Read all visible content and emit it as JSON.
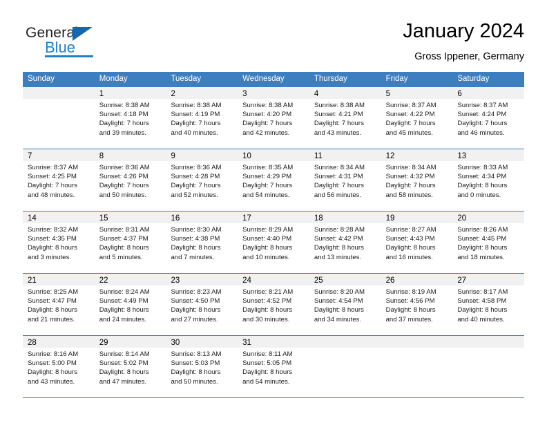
{
  "logo": {
    "word1": "General",
    "word2": "Blue",
    "triangle_icon": "triangle-icon",
    "color_dark": "#231f20",
    "color_blue": "#1f7fc4"
  },
  "header": {
    "title": "January 2024",
    "subtitle": "Gross Ippener, Germany"
  },
  "theme": {
    "header_row_bg": "#3c7ebf",
    "day_band_bg": "#f1f1f1",
    "grid_line": "#3c7ebf"
  },
  "calendar": {
    "weekday_headers": [
      "Sunday",
      "Monday",
      "Tuesday",
      "Wednesday",
      "Thursday",
      "Friday",
      "Saturday"
    ],
    "weeks": [
      [
        {
          "day": "",
          "sunrise": "",
          "sunset": "",
          "daylight_line1": "",
          "daylight_line2": "",
          "empty": true
        },
        {
          "day": "1",
          "sunrise": "Sunrise: 8:38 AM",
          "sunset": "Sunset: 4:18 PM",
          "daylight_line1": "Daylight: 7 hours",
          "daylight_line2": "and 39 minutes."
        },
        {
          "day": "2",
          "sunrise": "Sunrise: 8:38 AM",
          "sunset": "Sunset: 4:19 PM",
          "daylight_line1": "Daylight: 7 hours",
          "daylight_line2": "and 40 minutes."
        },
        {
          "day": "3",
          "sunrise": "Sunrise: 8:38 AM",
          "sunset": "Sunset: 4:20 PM",
          "daylight_line1": "Daylight: 7 hours",
          "daylight_line2": "and 42 minutes."
        },
        {
          "day": "4",
          "sunrise": "Sunrise: 8:38 AM",
          "sunset": "Sunset: 4:21 PM",
          "daylight_line1": "Daylight: 7 hours",
          "daylight_line2": "and 43 minutes."
        },
        {
          "day": "5",
          "sunrise": "Sunrise: 8:37 AM",
          "sunset": "Sunset: 4:22 PM",
          "daylight_line1": "Daylight: 7 hours",
          "daylight_line2": "and 45 minutes."
        },
        {
          "day": "6",
          "sunrise": "Sunrise: 8:37 AM",
          "sunset": "Sunset: 4:24 PM",
          "daylight_line1": "Daylight: 7 hours",
          "daylight_line2": "and 46 minutes."
        }
      ],
      [
        {
          "day": "7",
          "sunrise": "Sunrise: 8:37 AM",
          "sunset": "Sunset: 4:25 PM",
          "daylight_line1": "Daylight: 7 hours",
          "daylight_line2": "and 48 minutes."
        },
        {
          "day": "8",
          "sunrise": "Sunrise: 8:36 AM",
          "sunset": "Sunset: 4:26 PM",
          "daylight_line1": "Daylight: 7 hours",
          "daylight_line2": "and 50 minutes."
        },
        {
          "day": "9",
          "sunrise": "Sunrise: 8:36 AM",
          "sunset": "Sunset: 4:28 PM",
          "daylight_line1": "Daylight: 7 hours",
          "daylight_line2": "and 52 minutes."
        },
        {
          "day": "10",
          "sunrise": "Sunrise: 8:35 AM",
          "sunset": "Sunset: 4:29 PM",
          "daylight_line1": "Daylight: 7 hours",
          "daylight_line2": "and 54 minutes."
        },
        {
          "day": "11",
          "sunrise": "Sunrise: 8:34 AM",
          "sunset": "Sunset: 4:31 PM",
          "daylight_line1": "Daylight: 7 hours",
          "daylight_line2": "and 56 minutes."
        },
        {
          "day": "12",
          "sunrise": "Sunrise: 8:34 AM",
          "sunset": "Sunset: 4:32 PM",
          "daylight_line1": "Daylight: 7 hours",
          "daylight_line2": "and 58 minutes."
        },
        {
          "day": "13",
          "sunrise": "Sunrise: 8:33 AM",
          "sunset": "Sunset: 4:34 PM",
          "daylight_line1": "Daylight: 8 hours",
          "daylight_line2": "and 0 minutes."
        }
      ],
      [
        {
          "day": "14",
          "sunrise": "Sunrise: 8:32 AM",
          "sunset": "Sunset: 4:35 PM",
          "daylight_line1": "Daylight: 8 hours",
          "daylight_line2": "and 3 minutes."
        },
        {
          "day": "15",
          "sunrise": "Sunrise: 8:31 AM",
          "sunset": "Sunset: 4:37 PM",
          "daylight_line1": "Daylight: 8 hours",
          "daylight_line2": "and 5 minutes."
        },
        {
          "day": "16",
          "sunrise": "Sunrise: 8:30 AM",
          "sunset": "Sunset: 4:38 PM",
          "daylight_line1": "Daylight: 8 hours",
          "daylight_line2": "and 7 minutes."
        },
        {
          "day": "17",
          "sunrise": "Sunrise: 8:29 AM",
          "sunset": "Sunset: 4:40 PM",
          "daylight_line1": "Daylight: 8 hours",
          "daylight_line2": "and 10 minutes."
        },
        {
          "day": "18",
          "sunrise": "Sunrise: 8:28 AM",
          "sunset": "Sunset: 4:42 PM",
          "daylight_line1": "Daylight: 8 hours",
          "daylight_line2": "and 13 minutes."
        },
        {
          "day": "19",
          "sunrise": "Sunrise: 8:27 AM",
          "sunset": "Sunset: 4:43 PM",
          "daylight_line1": "Daylight: 8 hours",
          "daylight_line2": "and 16 minutes."
        },
        {
          "day": "20",
          "sunrise": "Sunrise: 8:26 AM",
          "sunset": "Sunset: 4:45 PM",
          "daylight_line1": "Daylight: 8 hours",
          "daylight_line2": "and 18 minutes."
        }
      ],
      [
        {
          "day": "21",
          "sunrise": "Sunrise: 8:25 AM",
          "sunset": "Sunset: 4:47 PM",
          "daylight_line1": "Daylight: 8 hours",
          "daylight_line2": "and 21 minutes."
        },
        {
          "day": "22",
          "sunrise": "Sunrise: 8:24 AM",
          "sunset": "Sunset: 4:49 PM",
          "daylight_line1": "Daylight: 8 hours",
          "daylight_line2": "and 24 minutes."
        },
        {
          "day": "23",
          "sunrise": "Sunrise: 8:23 AM",
          "sunset": "Sunset: 4:50 PM",
          "daylight_line1": "Daylight: 8 hours",
          "daylight_line2": "and 27 minutes."
        },
        {
          "day": "24",
          "sunrise": "Sunrise: 8:21 AM",
          "sunset": "Sunset: 4:52 PM",
          "daylight_line1": "Daylight: 8 hours",
          "daylight_line2": "and 30 minutes."
        },
        {
          "day": "25",
          "sunrise": "Sunrise: 8:20 AM",
          "sunset": "Sunset: 4:54 PM",
          "daylight_line1": "Daylight: 8 hours",
          "daylight_line2": "and 34 minutes."
        },
        {
          "day": "26",
          "sunrise": "Sunrise: 8:19 AM",
          "sunset": "Sunset: 4:56 PM",
          "daylight_line1": "Daylight: 8 hours",
          "daylight_line2": "and 37 minutes."
        },
        {
          "day": "27",
          "sunrise": "Sunrise: 8:17 AM",
          "sunset": "Sunset: 4:58 PM",
          "daylight_line1": "Daylight: 8 hours",
          "daylight_line2": "and 40 minutes."
        }
      ],
      [
        {
          "day": "28",
          "sunrise": "Sunrise: 8:16 AM",
          "sunset": "Sunset: 5:00 PM",
          "daylight_line1": "Daylight: 8 hours",
          "daylight_line2": "and 43 minutes."
        },
        {
          "day": "29",
          "sunrise": "Sunrise: 8:14 AM",
          "sunset": "Sunset: 5:02 PM",
          "daylight_line1": "Daylight: 8 hours",
          "daylight_line2": "and 47 minutes."
        },
        {
          "day": "30",
          "sunrise": "Sunrise: 8:13 AM",
          "sunset": "Sunset: 5:03 PM",
          "daylight_line1": "Daylight: 8 hours",
          "daylight_line2": "and 50 minutes."
        },
        {
          "day": "31",
          "sunrise": "Sunrise: 8:11 AM",
          "sunset": "Sunset: 5:05 PM",
          "daylight_line1": "Daylight: 8 hours",
          "daylight_line2": "and 54 minutes."
        },
        {
          "day": "",
          "sunrise": "",
          "sunset": "",
          "daylight_line1": "",
          "daylight_line2": "",
          "empty": true
        },
        {
          "day": "",
          "sunrise": "",
          "sunset": "",
          "daylight_line1": "",
          "daylight_line2": "",
          "empty": true
        },
        {
          "day": "",
          "sunrise": "",
          "sunset": "",
          "daylight_line1": "",
          "daylight_line2": "",
          "empty": true
        }
      ]
    ]
  }
}
